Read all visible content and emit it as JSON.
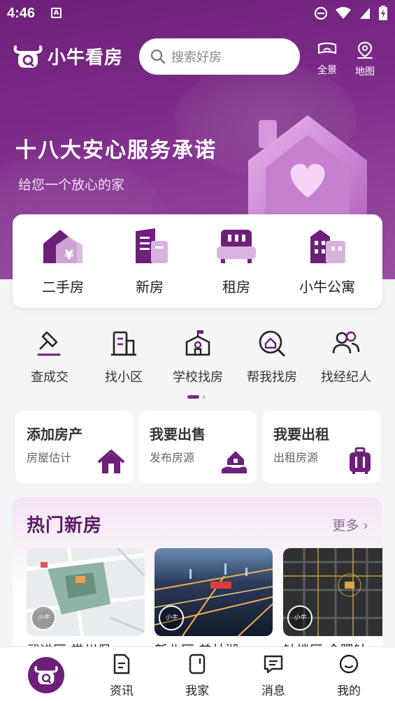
{
  "status_bar": {
    "time": "4:46",
    "notif_glyph": "A"
  },
  "header": {
    "brand": "小牛看房",
    "search": {
      "placeholder": "搜索好房"
    },
    "icons": [
      {
        "name": "panorama-icon",
        "label": "全景"
      },
      {
        "name": "map-pin-icon",
        "label": "地图"
      }
    ]
  },
  "banner": {
    "title": "十八大安心服务承诺",
    "subtitle": "给您一个放心的家"
  },
  "categories": [
    {
      "name": "second-hand-house",
      "icon": "house-yen-icon",
      "label": "二手房"
    },
    {
      "name": "new-house",
      "icon": "building-icon",
      "label": "新房"
    },
    {
      "name": "rent",
      "icon": "sofa-icon",
      "label": "租房"
    },
    {
      "name": "apartment",
      "icon": "apartment-icon",
      "label": "小牛公寓"
    }
  ],
  "tools": [
    {
      "name": "check-deal",
      "icon": "gavel-icon",
      "label": "查成交"
    },
    {
      "name": "find-community",
      "icon": "community-building-icon",
      "label": "找小区"
    },
    {
      "name": "school-house",
      "icon": "school-icon",
      "label": "学校找房"
    },
    {
      "name": "help-find",
      "icon": "search-house-icon",
      "label": "帮我找房"
    },
    {
      "name": "find-agent",
      "icon": "people-icon",
      "label": "找经纪人"
    }
  ],
  "actions": [
    {
      "title": "添加房产",
      "subtitle": "房屋估计",
      "icon": "house-icon"
    },
    {
      "title": "我要出售",
      "subtitle": "发布房源",
      "icon": "hand-house-icon"
    },
    {
      "title": "我要出租",
      "subtitle": "出租房源",
      "icon": "suitcase-icon"
    }
  ],
  "hot_new": {
    "title": "热门新房",
    "more": "更多",
    "items": [
      {
        "title": "武进区 常州保",
        "badge": "小牛"
      },
      {
        "title": "新北区 美林湖",
        "badge": "小牛"
      },
      {
        "title": "钟楼区 金隅钟",
        "badge": "小牛"
      }
    ]
  },
  "tabbar": {
    "tabs": [
      {
        "name": "home",
        "icon": "niu-logo-icon",
        "label": ""
      },
      {
        "name": "news",
        "icon": "document-icon",
        "label": "资讯"
      },
      {
        "name": "my-home",
        "icon": "phone-home-icon",
        "label": "我家"
      },
      {
        "name": "messages",
        "icon": "chat-icon",
        "label": "消息"
      },
      {
        "name": "mine",
        "icon": "smile-icon",
        "label": "我的"
      }
    ]
  },
  "colors": {
    "brand": "#6d1f79",
    "accent_light": "#b58bbd"
  }
}
